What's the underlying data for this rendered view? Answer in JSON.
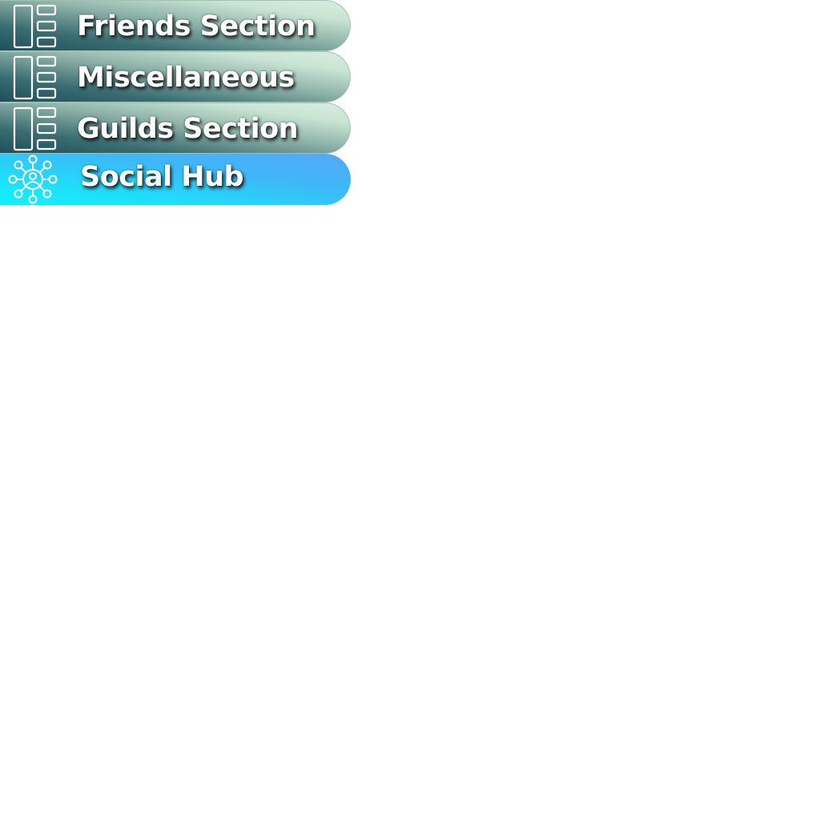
{
  "menu": {
    "items": [
      {
        "label": "Friends Section",
        "icon": "list-layout-icon",
        "active": false
      },
      {
        "label": "Miscellaneous",
        "icon": "list-layout-icon",
        "active": false
      },
      {
        "label": "Guilds Section",
        "icon": "list-layout-icon",
        "active": false
      },
      {
        "label": "Social Hub",
        "icon": "network-hub-icon",
        "active": true
      }
    ]
  },
  "colors": {
    "default_dark": "#1f4f5c",
    "default_light": "#d8efe0",
    "active_cyan": "#12f2ff",
    "active_blue": "#56a8f6",
    "label_text": "#ffffff"
  }
}
